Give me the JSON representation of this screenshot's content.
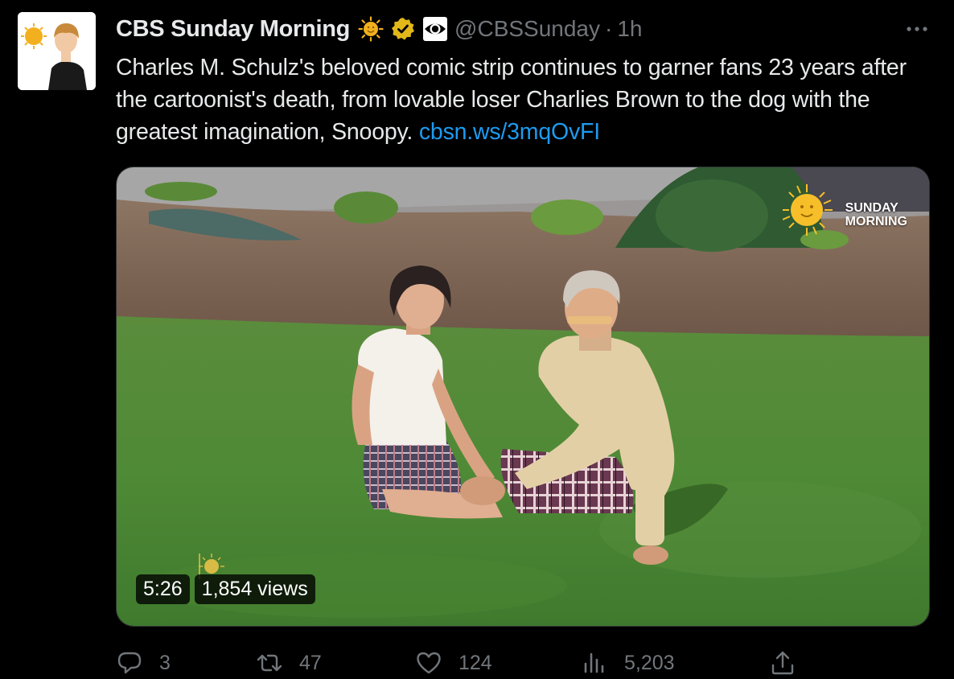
{
  "author": {
    "name": "CBS Sunday Morning",
    "handle": "@CBSSunday",
    "time": "1h",
    "separator": "·",
    "badges": [
      "sun-badge-icon",
      "verified-gold-icon",
      "cbs-eye-icon"
    ]
  },
  "tweet": {
    "text": "Charles M. Schulz's beloved comic strip continues to garner fans 23 years after the cartoonist's death, from lovable loser Charlies Brown to the dog with the greatest imagination, Snoopy. ",
    "link": "cbsn.ws/3mqOvFI"
  },
  "media": {
    "duration": "5:26",
    "views": "1,854 views",
    "watermark": [
      "SUNDAY",
      "MORNING"
    ]
  },
  "actions": {
    "replies": "3",
    "retweets": "47",
    "likes": "124",
    "views": "5,203"
  },
  "colors": {
    "background": "#000000",
    "text": "#e7e9ea",
    "muted": "#71767b",
    "link": "#1d9bf0",
    "verified": "#e2b719"
  }
}
